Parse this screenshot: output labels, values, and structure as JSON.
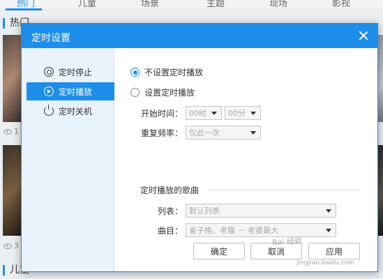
{
  "background": {
    "tabs": [
      {
        "label": "热门",
        "active": true
      },
      {
        "label": "儿童"
      },
      {
        "label": "场景"
      },
      {
        "label": "主题"
      },
      {
        "label": "现场"
      },
      {
        "label": "影视"
      }
    ],
    "section_hot": "热门",
    "section_kids": "儿童",
    "play_count_1": "1",
    "play_count_2": "3"
  },
  "dialog": {
    "title": "定时设置",
    "sidebar": [
      {
        "label": "定时停止",
        "icon": "stop-timer-icon"
      },
      {
        "label": "定时播放",
        "icon": "play-timer-icon",
        "active": true
      },
      {
        "label": "定时关机",
        "icon": "power-icon"
      }
    ],
    "options": {
      "no_timer": "不设置定时播放",
      "set_timer": "设置定时播放",
      "selected": "no_timer"
    },
    "start_time_label": "开始时间：",
    "hour_value": "00时",
    "minute_value": "00分",
    "repeat_label": "重复频率：",
    "repeat_value": "仅此一次",
    "songs_group_title": "定时播放的歌曲",
    "list_label": "列表：",
    "list_value": "默认列表",
    "track_label": "曲目：",
    "track_value": "雀子格、老猫 － 老婆最大",
    "buttons": {
      "confirm": "确定",
      "cancel": "取消",
      "apply": "应用"
    }
  },
  "colors": {
    "accent": "#1d8ee9",
    "sidebar_bg": "#e8f2fa"
  },
  "watermark": {
    "text": "Bai 经验",
    "url": "jingyan.baidu.com"
  }
}
